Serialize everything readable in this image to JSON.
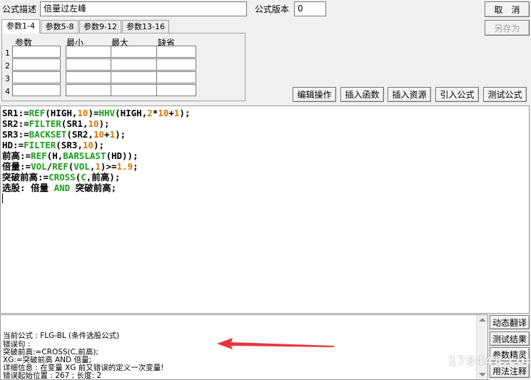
{
  "header": {
    "desc_label": "公式描述",
    "desc_value": "倍量过左峰",
    "version_label": "公式版本",
    "version_value": "0"
  },
  "buttons": {
    "cancel": "取　消",
    "save_as": "另存为",
    "edit_op": "编辑操作",
    "insert_func": "插入函数",
    "insert_res": "插入资源",
    "import_formula": "引入公式",
    "test_formula": "测试公式",
    "dyn_translate": "动态翻译",
    "test_result": "测试结果",
    "param_tune": "参数精灵",
    "usage_note": "用法注释"
  },
  "tabs": [
    {
      "label": "参数1-4"
    },
    {
      "label": "参数5-8"
    },
    {
      "label": "参数9-12"
    },
    {
      "label": "参数13-16"
    }
  ],
  "params": {
    "headers": [
      "参数",
      "最小",
      "最大",
      "缺省"
    ],
    "rows": [
      "1",
      "2",
      "3",
      "4"
    ]
  },
  "code": [
    [
      [
        "SR1:=",
        "op"
      ],
      [
        "REF",
        "fn"
      ],
      [
        "(HIGH,",
        "op"
      ],
      [
        "10",
        "num"
      ],
      [
        ")=",
        "op"
      ],
      [
        "HHV",
        "fn"
      ],
      [
        "(HIGH,",
        "op"
      ],
      [
        "2",
        "num"
      ],
      [
        "*",
        "op"
      ],
      [
        "10",
        "num"
      ],
      [
        "+",
        "op"
      ],
      [
        "1",
        "num"
      ],
      [
        ");",
        "op"
      ]
    ],
    [
      [
        "SR2:=",
        "op"
      ],
      [
        "FILTER",
        "fn"
      ],
      [
        "(SR1,",
        "op"
      ],
      [
        "10",
        "num"
      ],
      [
        ");",
        "op"
      ]
    ],
    [
      [
        "SR3:=",
        "op"
      ],
      [
        "BACKSET",
        "fn"
      ],
      [
        "(SR2,",
        "op"
      ],
      [
        "10",
        "num"
      ],
      [
        "+",
        "op"
      ],
      [
        "1",
        "num"
      ],
      [
        ");",
        "op"
      ]
    ],
    [
      [
        "HD:=",
        "op"
      ],
      [
        "FILTER",
        "fn"
      ],
      [
        "(SR3,",
        "op"
      ],
      [
        "10",
        "num"
      ],
      [
        ");",
        "op"
      ]
    ],
    [
      [
        "前高:=",
        "op"
      ],
      [
        "REF",
        "fn"
      ],
      [
        "(H,",
        "op"
      ],
      [
        "BARSLAST",
        "fn"
      ],
      [
        "(HD));",
        "op"
      ]
    ],
    [
      [
        "倍量:=",
        "op"
      ],
      [
        "VOL",
        "fn"
      ],
      [
        "/",
        "op"
      ],
      [
        "REF",
        "fn"
      ],
      [
        "(",
        "op"
      ],
      [
        "VOL",
        "fn"
      ],
      [
        ",",
        "op"
      ],
      [
        "1",
        "num"
      ],
      [
        ")>=",
        "op"
      ],
      [
        "1.9",
        "num"
      ],
      [
        ";",
        "op"
      ]
    ],
    [
      [
        "突破前高:=",
        "op"
      ],
      [
        "CROSS",
        "fn"
      ],
      [
        "(",
        "op"
      ],
      [
        "C",
        "fn"
      ],
      [
        ",前高);",
        "op"
      ]
    ],
    [
      [
        "选股: 倍量 ",
        "op"
      ],
      [
        "AND",
        "fn"
      ],
      [
        " 突破前高;",
        "op"
      ]
    ]
  ],
  "messages": [
    "当前公式 : FLG-BL (条件选股公式)",
    "错误句 :",
    "突破前高:=CROSS(C,前高);",
    "XG:=突破前高 AND 倍量;",
    "详细信息 : 在变量 XG 前又错误的定义一次变量!",
    "错误起始位置 : 267 ; 长度: 2"
  ],
  "watermark": "178448.com",
  "arrow_color": "#e8343c"
}
